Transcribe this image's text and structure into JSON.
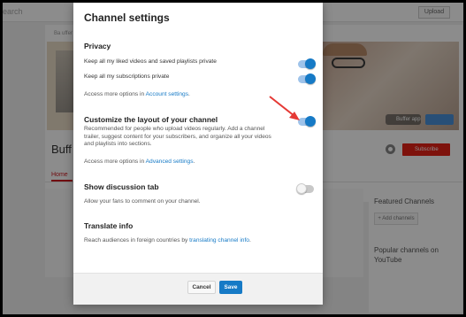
{
  "background": {
    "search_placeholder": "earch",
    "upload_label": "Upload",
    "tiny_label": "Ba uffer",
    "banner_pill": "Buffer app",
    "channel_name": "Buff",
    "home_tab": "Home",
    "subscribe_label": "Subscribe",
    "featured_channels": "Featured Channels",
    "add_channels": "+ Add channels",
    "popular_channels": "Popular channels on YouTube"
  },
  "dialog": {
    "title": "Channel settings",
    "privacy": {
      "heading": "Privacy",
      "liked_private": "Keep all my liked videos and saved playlists private",
      "subscriptions_private": "Keep all my subscriptions private",
      "more_prefix": "Access more options in ",
      "more_link": "Account settings",
      "more_suffix": "."
    },
    "layout": {
      "heading": "Customize the layout of your channel",
      "description": "Recommended for people who upload videos regularly. Add a channel trailer, suggest content for your subscribers, and organize all your videos and playlists into sections.",
      "more_prefix": "Access more options in ",
      "more_link": "Advanced settings",
      "more_suffix": "."
    },
    "discussion": {
      "heading": "Show discussion tab",
      "description": "Allow your fans to comment on your channel."
    },
    "translate": {
      "heading": "Translate info",
      "prefix": "Reach audiences in foreign countries by ",
      "link": "translating channel info",
      "suffix": "."
    },
    "toggles": {
      "liked_private": true,
      "subscriptions_private": true,
      "customize_layout": true,
      "discussion_tab": false
    },
    "cancel_label": "Cancel",
    "save_label": "Save"
  },
  "colors": {
    "accent": "#167ac6",
    "arrow": "#e53935",
    "subscribe": "#e62117"
  }
}
